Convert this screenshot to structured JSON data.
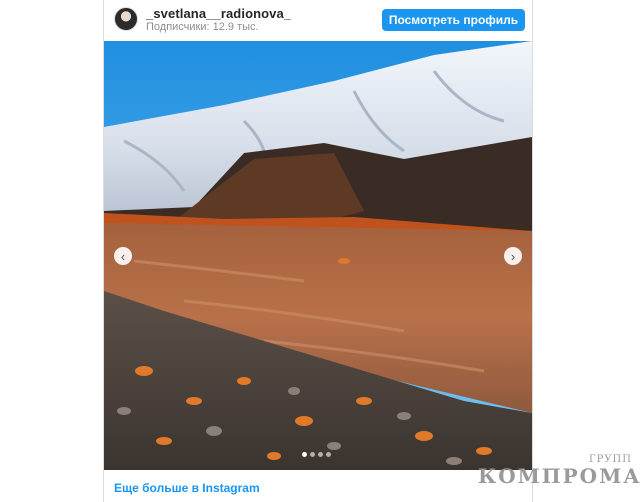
{
  "post": {
    "username": "_svetlana__radionova_",
    "followers": "Подписчики: 12.9 тыс.",
    "view_profile_label": "Посмотреть профиль",
    "more_link": "Еще больше в Instagram",
    "carousel": {
      "slides": 4,
      "active": 1
    }
  },
  "icons": {
    "prev": "chevron-left-icon",
    "next": "chevron-right-icon"
  },
  "watermark": {
    "small": "ГРУПП",
    "big": "КОМПРОМАТ"
  },
  "colors": {
    "accent": "#1a95f0",
    "username": "#262626",
    "muted": "#8e8e8e"
  }
}
